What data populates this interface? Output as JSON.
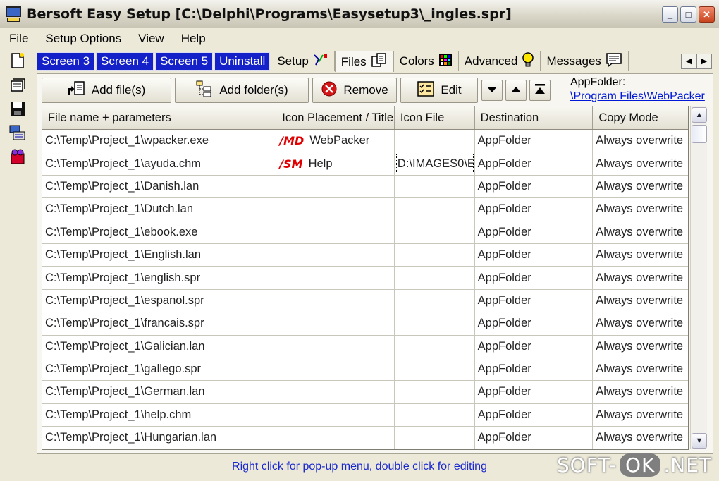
{
  "window": {
    "title": "Bersoft Easy Setup [C:\\Delphi\\Programs\\Easysetup3\\_ingles.spr]",
    "min": "_",
    "max": "□",
    "close": "✕"
  },
  "menu": [
    "File",
    "Setup Options",
    "View",
    "Help"
  ],
  "tabs": {
    "screens": [
      "Screen 3",
      "Screen 4",
      "Screen 5",
      "Uninstall"
    ],
    "setup": "Setup",
    "files": "Files",
    "colors": "Colors",
    "advanced": "Advanced",
    "messages": "Messages"
  },
  "toolbar": {
    "add_files": "Add file(s)",
    "add_folder": "Add folder(s)",
    "remove": "Remove",
    "edit": "Edit",
    "appfolder_label": "AppFolder:",
    "appfolder_link": "\\Program Files\\WebPacker"
  },
  "grid": {
    "columns": [
      "File name + parameters",
      "Icon Placement / Title",
      "Icon File",
      "Destination",
      "Copy Mode"
    ],
    "rows": [
      {
        "file": "C:\\Temp\\Project_1\\wpacker.exe",
        "tag": "/MD",
        "title": "WebPacker",
        "icon": "",
        "dest": "AppFolder",
        "mode": "Always overwrite"
      },
      {
        "file": "C:\\Temp\\Project_1\\ayuda.chm",
        "tag": "/SM",
        "title": "Help",
        "icon": "D:\\IMAGES0\\E",
        "dest": "AppFolder",
        "mode": "Always overwrite"
      },
      {
        "file": "C:\\Temp\\Project_1\\Danish.lan",
        "tag": "",
        "title": "",
        "icon": "",
        "dest": "AppFolder",
        "mode": "Always overwrite"
      },
      {
        "file": "C:\\Temp\\Project_1\\Dutch.lan",
        "tag": "",
        "title": "",
        "icon": "",
        "dest": "AppFolder",
        "mode": "Always overwrite"
      },
      {
        "file": "C:\\Temp\\Project_1\\ebook.exe",
        "tag": "",
        "title": "",
        "icon": "",
        "dest": "AppFolder",
        "mode": "Always overwrite"
      },
      {
        "file": "C:\\Temp\\Project_1\\English.lan",
        "tag": "",
        "title": "",
        "icon": "",
        "dest": "AppFolder",
        "mode": "Always overwrite"
      },
      {
        "file": "C:\\Temp\\Project_1\\english.spr",
        "tag": "",
        "title": "",
        "icon": "",
        "dest": "AppFolder",
        "mode": "Always overwrite"
      },
      {
        "file": "C:\\Temp\\Project_1\\espanol.spr",
        "tag": "",
        "title": "",
        "icon": "",
        "dest": "AppFolder",
        "mode": "Always overwrite"
      },
      {
        "file": "C:\\Temp\\Project_1\\francais.spr",
        "tag": "",
        "title": "",
        "icon": "",
        "dest": "AppFolder",
        "mode": "Always overwrite"
      },
      {
        "file": "C:\\Temp\\Project_1\\Galician.lan",
        "tag": "",
        "title": "",
        "icon": "",
        "dest": "AppFolder",
        "mode": "Always overwrite"
      },
      {
        "file": "C:\\Temp\\Project_1\\gallego.spr",
        "tag": "",
        "title": "",
        "icon": "",
        "dest": "AppFolder",
        "mode": "Always overwrite"
      },
      {
        "file": "C:\\Temp\\Project_1\\German.lan",
        "tag": "",
        "title": "",
        "icon": "",
        "dest": "AppFolder",
        "mode": "Always overwrite"
      },
      {
        "file": "C:\\Temp\\Project_1\\help.chm",
        "tag": "",
        "title": "",
        "icon": "",
        "dest": "AppFolder",
        "mode": "Always overwrite"
      },
      {
        "file": "C:\\Temp\\Project_1\\Hungarian.lan",
        "tag": "",
        "title": "",
        "icon": "",
        "dest": "AppFolder",
        "mode": "Always overwrite"
      }
    ]
  },
  "status": "Right click for pop-up menu, double click for editing",
  "watermark": {
    "left": "SOFT-",
    "mid": "OK",
    "right": ".NET"
  }
}
